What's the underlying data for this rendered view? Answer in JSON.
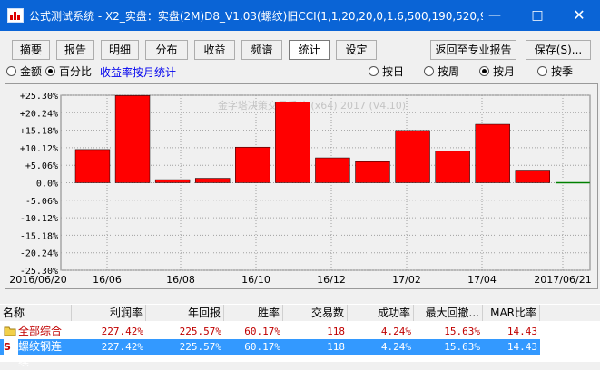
{
  "window": {
    "title": "公式测试系统 - X2_实盘：实盘(2M)D8_V1.03(螺纹)旧CCI(1,1,20,20,0,1.6,500,190,520,99..."
  },
  "toolbar": {
    "buttons": [
      "摘要",
      "报告",
      "明细",
      "分布",
      "收益",
      "频谱",
      "统计",
      "设定"
    ],
    "active": "统计",
    "return_label": "返回至专业报告",
    "save_label": "保存(S)..."
  },
  "options": {
    "mode_amount": "金额",
    "mode_percent": "百分比",
    "mode_selected": "百分比",
    "link_text": "收益率按月统计",
    "period_day": "按日",
    "period_week": "按周",
    "period_month": "按月",
    "period_quarter": "按季",
    "period_selected": "按月"
  },
  "chart_data": {
    "type": "bar",
    "watermark": "金字塔决策交易系统 (x64) 2017 (V4.10)",
    "y_ticks": [
      "+25.30%",
      "+20.24%",
      "+15.18%",
      "+10.12%",
      "+5.06%",
      "0.0%",
      "-5.06%",
      "-10.12%",
      "-15.18%",
      "-20.24%",
      "-25.30%"
    ],
    "ylim": [
      -25.3,
      25.3
    ],
    "x_ticks": [
      "2016/06/20",
      "16/06",
      "16/08",
      "16/10",
      "16/12",
      "17/02",
      "17/04",
      "2017/06/21"
    ],
    "categories": [
      "2016/06",
      "2016/07",
      "2016/08",
      "2016/09",
      "2016/10",
      "2016/11",
      "2016/12",
      "2017/01",
      "2017/02",
      "2017/03",
      "2017/04",
      "2017/05",
      "2017/06"
    ],
    "values": [
      9.6,
      25.2,
      0.9,
      1.3,
      10.3,
      23.4,
      7.2,
      6.1,
      15.1,
      9.1,
      16.9,
      3.4,
      -0.3
    ],
    "positive_color": "#ff0000",
    "negative_color": "#008000",
    "grid": true
  },
  "table": {
    "headers": [
      "名称",
      "利润率",
      "年回报",
      "胜率",
      "交易数",
      "成功率",
      "最大回撤...",
      "MAR比率"
    ],
    "rows": [
      {
        "icon": "folder-icon",
        "name": "全部综合",
        "values": [
          "227.42%",
          "225.57%",
          "60.17%",
          "118",
          "4.24%",
          "15.63%",
          "14.43"
        ],
        "selected": false
      },
      {
        "icon": "s-icon",
        "icon_char": "S",
        "name": "螺纹钢连续",
        "values": [
          "227.42%",
          "225.57%",
          "60.17%",
          "118",
          "4.24%",
          "15.63%",
          "14.43"
        ],
        "selected": true
      }
    ]
  }
}
